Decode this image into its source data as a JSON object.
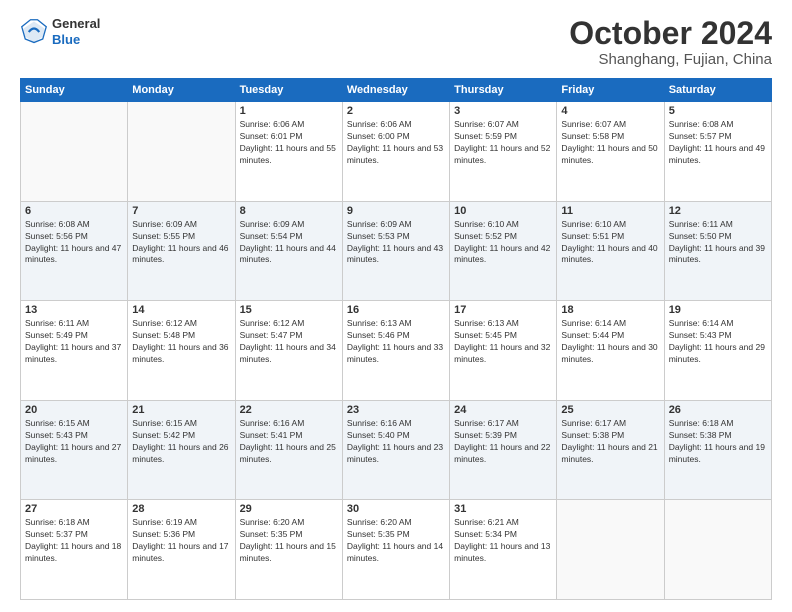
{
  "header": {
    "logo": {
      "general": "General",
      "blue": "Blue"
    },
    "title": "October 2024",
    "location": "Shanghang, Fujian, China"
  },
  "calendar": {
    "weekdays": [
      "Sunday",
      "Monday",
      "Tuesday",
      "Wednesday",
      "Thursday",
      "Friday",
      "Saturday"
    ],
    "weeks": [
      [
        {
          "day": "",
          "info": ""
        },
        {
          "day": "",
          "info": ""
        },
        {
          "day": "1",
          "info": "Sunrise: 6:06 AM\nSunset: 6:01 PM\nDaylight: 11 hours and 55 minutes."
        },
        {
          "day": "2",
          "info": "Sunrise: 6:06 AM\nSunset: 6:00 PM\nDaylight: 11 hours and 53 minutes."
        },
        {
          "day": "3",
          "info": "Sunrise: 6:07 AM\nSunset: 5:59 PM\nDaylight: 11 hours and 52 minutes."
        },
        {
          "day": "4",
          "info": "Sunrise: 6:07 AM\nSunset: 5:58 PM\nDaylight: 11 hours and 50 minutes."
        },
        {
          "day": "5",
          "info": "Sunrise: 6:08 AM\nSunset: 5:57 PM\nDaylight: 11 hours and 49 minutes."
        }
      ],
      [
        {
          "day": "6",
          "info": "Sunrise: 6:08 AM\nSunset: 5:56 PM\nDaylight: 11 hours and 47 minutes."
        },
        {
          "day": "7",
          "info": "Sunrise: 6:09 AM\nSunset: 5:55 PM\nDaylight: 11 hours and 46 minutes."
        },
        {
          "day": "8",
          "info": "Sunrise: 6:09 AM\nSunset: 5:54 PM\nDaylight: 11 hours and 44 minutes."
        },
        {
          "day": "9",
          "info": "Sunrise: 6:09 AM\nSunset: 5:53 PM\nDaylight: 11 hours and 43 minutes."
        },
        {
          "day": "10",
          "info": "Sunrise: 6:10 AM\nSunset: 5:52 PM\nDaylight: 11 hours and 42 minutes."
        },
        {
          "day": "11",
          "info": "Sunrise: 6:10 AM\nSunset: 5:51 PM\nDaylight: 11 hours and 40 minutes."
        },
        {
          "day": "12",
          "info": "Sunrise: 6:11 AM\nSunset: 5:50 PM\nDaylight: 11 hours and 39 minutes."
        }
      ],
      [
        {
          "day": "13",
          "info": "Sunrise: 6:11 AM\nSunset: 5:49 PM\nDaylight: 11 hours and 37 minutes."
        },
        {
          "day": "14",
          "info": "Sunrise: 6:12 AM\nSunset: 5:48 PM\nDaylight: 11 hours and 36 minutes."
        },
        {
          "day": "15",
          "info": "Sunrise: 6:12 AM\nSunset: 5:47 PM\nDaylight: 11 hours and 34 minutes."
        },
        {
          "day": "16",
          "info": "Sunrise: 6:13 AM\nSunset: 5:46 PM\nDaylight: 11 hours and 33 minutes."
        },
        {
          "day": "17",
          "info": "Sunrise: 6:13 AM\nSunset: 5:45 PM\nDaylight: 11 hours and 32 minutes."
        },
        {
          "day": "18",
          "info": "Sunrise: 6:14 AM\nSunset: 5:44 PM\nDaylight: 11 hours and 30 minutes."
        },
        {
          "day": "19",
          "info": "Sunrise: 6:14 AM\nSunset: 5:43 PM\nDaylight: 11 hours and 29 minutes."
        }
      ],
      [
        {
          "day": "20",
          "info": "Sunrise: 6:15 AM\nSunset: 5:43 PM\nDaylight: 11 hours and 27 minutes."
        },
        {
          "day": "21",
          "info": "Sunrise: 6:15 AM\nSunset: 5:42 PM\nDaylight: 11 hours and 26 minutes."
        },
        {
          "day": "22",
          "info": "Sunrise: 6:16 AM\nSunset: 5:41 PM\nDaylight: 11 hours and 25 minutes."
        },
        {
          "day": "23",
          "info": "Sunrise: 6:16 AM\nSunset: 5:40 PM\nDaylight: 11 hours and 23 minutes."
        },
        {
          "day": "24",
          "info": "Sunrise: 6:17 AM\nSunset: 5:39 PM\nDaylight: 11 hours and 22 minutes."
        },
        {
          "day": "25",
          "info": "Sunrise: 6:17 AM\nSunset: 5:38 PM\nDaylight: 11 hours and 21 minutes."
        },
        {
          "day": "26",
          "info": "Sunrise: 6:18 AM\nSunset: 5:38 PM\nDaylight: 11 hours and 19 minutes."
        }
      ],
      [
        {
          "day": "27",
          "info": "Sunrise: 6:18 AM\nSunset: 5:37 PM\nDaylight: 11 hours and 18 minutes."
        },
        {
          "day": "28",
          "info": "Sunrise: 6:19 AM\nSunset: 5:36 PM\nDaylight: 11 hours and 17 minutes."
        },
        {
          "day": "29",
          "info": "Sunrise: 6:20 AM\nSunset: 5:35 PM\nDaylight: 11 hours and 15 minutes."
        },
        {
          "day": "30",
          "info": "Sunrise: 6:20 AM\nSunset: 5:35 PM\nDaylight: 11 hours and 14 minutes."
        },
        {
          "day": "31",
          "info": "Sunrise: 6:21 AM\nSunset: 5:34 PM\nDaylight: 11 hours and 13 minutes."
        },
        {
          "day": "",
          "info": ""
        },
        {
          "day": "",
          "info": ""
        }
      ]
    ]
  }
}
